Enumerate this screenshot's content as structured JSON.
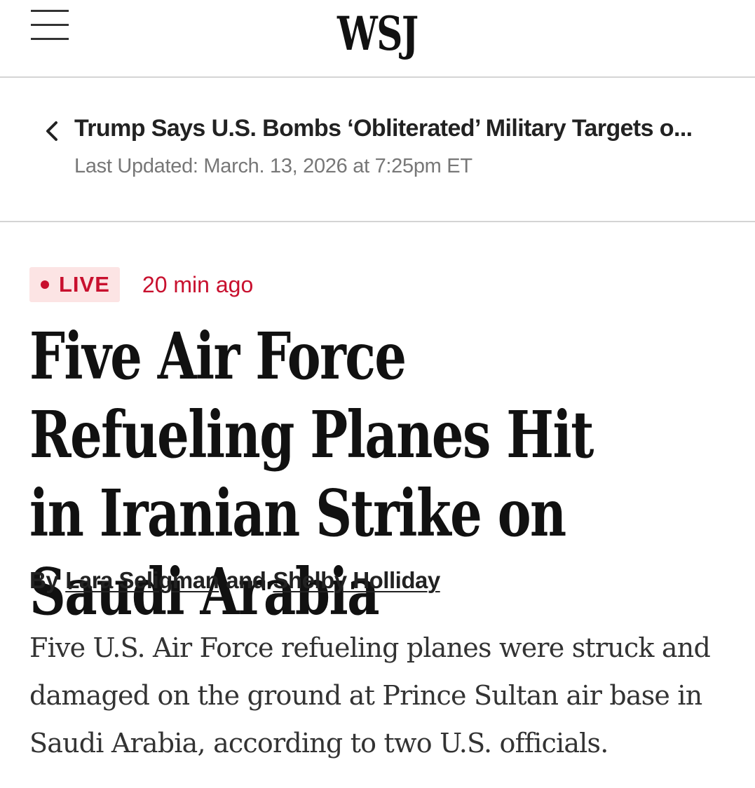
{
  "header": {
    "logo": "WSJ",
    "menu_icon": "hamburger-menu-icon"
  },
  "back_nav": {
    "icon": "chevron-left-icon",
    "title": "Trump Says U.S. Bombs ‘Obliterated’ Military Targets o...",
    "last_updated": "Last Updated: March. 13, 2026 at 7:25pm ET"
  },
  "live": {
    "label": "LIVE",
    "time_ago": "20 min ago",
    "color": "#c8102e",
    "badge_bg": "#fce4e4"
  },
  "article": {
    "headline": "Five Air Force Refueling Planes Hit in Iranian Strike on Saudi Arabia",
    "byline": {
      "by": "By",
      "author1": "Lara Seligman",
      "conjunction": "and",
      "author2": "Shelby Holliday"
    },
    "summary": "Five U.S. Air Force refueling planes were struck and damaged on the ground at Prince Sultan air base in Saudi Arabia, according to two U.S. officials."
  }
}
